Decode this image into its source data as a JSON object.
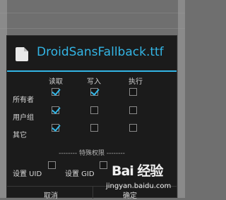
{
  "dialog": {
    "title": "DroidSansFallback.ttf",
    "columns": [
      "读取",
      "写入",
      "执行"
    ],
    "rows": [
      {
        "label": "所有者",
        "read": true,
        "write": true,
        "execute": false
      },
      {
        "label": "用户组",
        "read": true,
        "write": false,
        "execute": false
      },
      {
        "label": "其它",
        "read": true,
        "write": false,
        "execute": false
      }
    ],
    "special_section": "-------- 特殊权限 --------",
    "set_uid": "设置 UID",
    "set_gid": "设置 GID",
    "cancel": "取消",
    "ok": "确定",
    "accent_color": "#33b5e5"
  },
  "watermark": {
    "logo": "Bai 经验",
    "url": "jingyan.baidu.com"
  }
}
